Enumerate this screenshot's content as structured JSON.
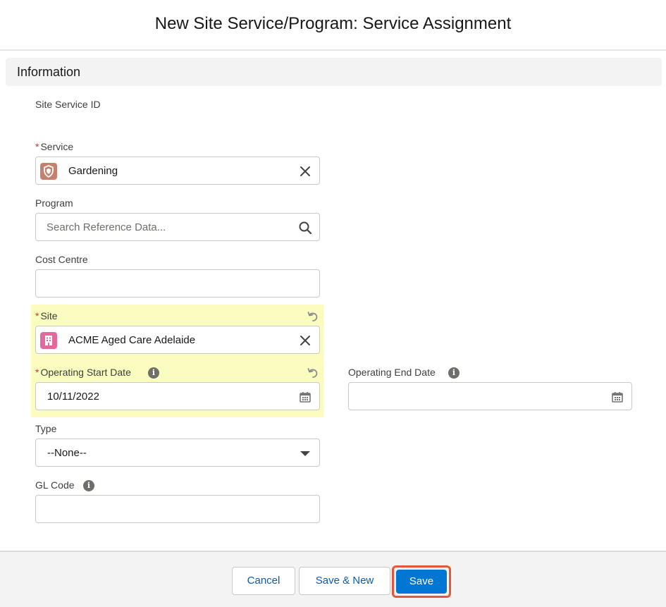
{
  "modal": {
    "title": "New Site Service/Program: Service Assignment"
  },
  "section": {
    "title": "Information"
  },
  "fields": {
    "site_service_id": {
      "label": "Site Service ID"
    },
    "service": {
      "required": "*",
      "label": "Service",
      "value": "Gardening",
      "icon": "service-shield-icon",
      "icon_color": "#c4816b"
    },
    "program": {
      "label": "Program",
      "placeholder": "Search Reference Data..."
    },
    "cost_centre": {
      "label": "Cost Centre",
      "value": ""
    },
    "site": {
      "required": "*",
      "label": "Site",
      "value": "ACME Aged Care Adelaide",
      "icon": "building-icon",
      "icon_color": "#e06b9a"
    },
    "operating_start_date": {
      "required": "*",
      "label": "Operating Start Date",
      "value": "10/11/2022"
    },
    "operating_end_date": {
      "label": "Operating End Date",
      "value": ""
    },
    "type": {
      "label": "Type",
      "value": "--None--"
    },
    "gl_code": {
      "label": "GL Code",
      "value": ""
    }
  },
  "footer": {
    "cancel_label": "Cancel",
    "save_new_label": "Save & New",
    "save_label": "Save"
  },
  "colors": {
    "brand": "#0176d3",
    "highlight": "#fafcc0",
    "required": "#c23934",
    "focus_outline": "#e2583e"
  }
}
